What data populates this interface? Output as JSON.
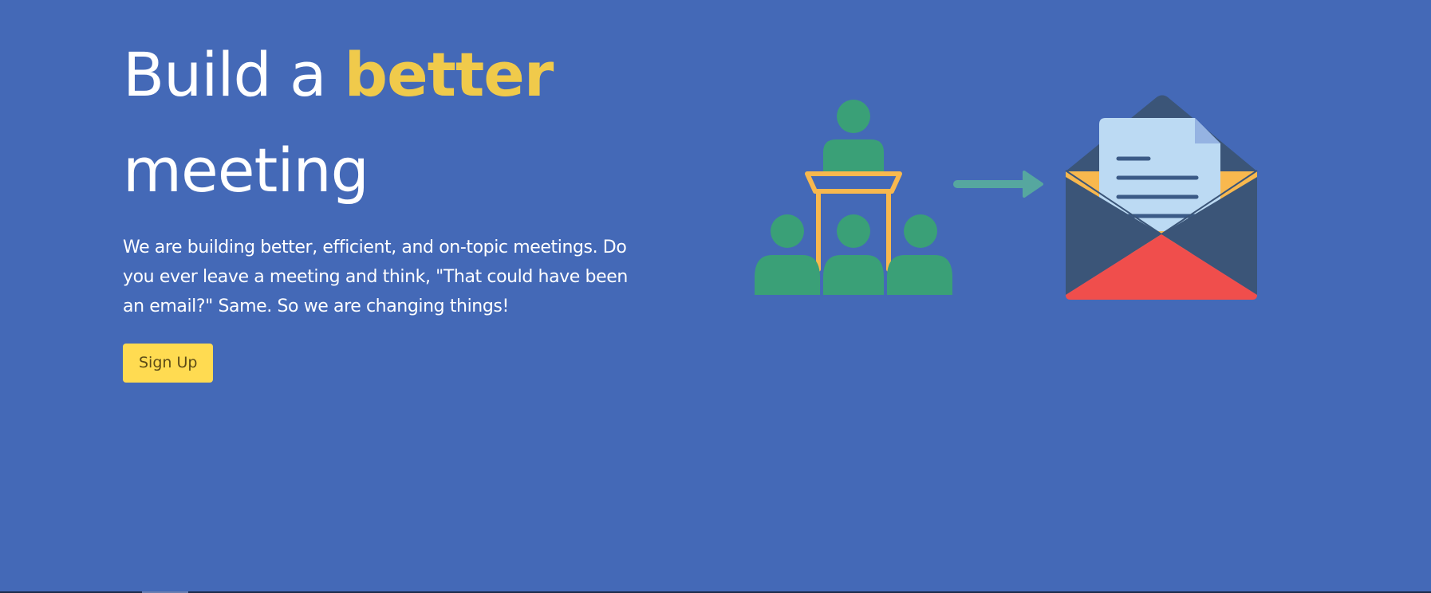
{
  "hero": {
    "title_part1": "Build a ",
    "title_accent": "better",
    "title_part2": "meeting",
    "description": "We are building better, efficient, and on-topic meetings. Do you ever leave a meeting and think, \"That could have been an email?\" Same. So we are changing things!",
    "signup_label": "Sign Up"
  },
  "illustration": {
    "icons": [
      "meeting-presenter-icon",
      "audience-icon",
      "arrow-right-icon",
      "open-envelope-letter-icon"
    ]
  },
  "colors": {
    "background": "#4469b7",
    "accent_yellow": "#f0ca4b",
    "button": "#ffdb51",
    "people_green": "#3aa077",
    "podium_orange": "#f8b84e",
    "arrow_teal": "#56a79f",
    "envelope_dark": "#3b5578",
    "envelope_red": "#f04e4c",
    "letter_blue": "#bcdaf3"
  }
}
